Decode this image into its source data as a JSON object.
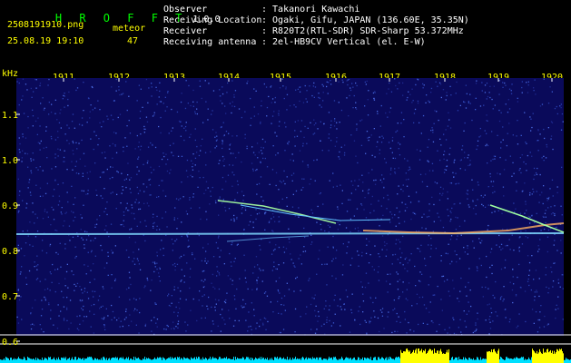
{
  "header": {
    "logo_text": "H R O F F T",
    "version": "1.0.0",
    "filename": "2508191910.png",
    "datetime": "25.08.19 19:10",
    "meteor_label": "meteor",
    "meteor_count": "47"
  },
  "info": {
    "rows": [
      {
        "label": "Observer",
        "value": ": Takanori Kawachi"
      },
      {
        "label": "Receiving Location",
        "value": ": Ogaki, Gifu, JAPAN (136.60E, 35.35N)"
      },
      {
        "label": "Receiver",
        "value": ": R820T2(RTL-SDR) SDR-Sharp 53.372MHz"
      },
      {
        "label": "Receiving antenna",
        "value": ": 2el-HB9CV Vertical (el. E-W)"
      }
    ]
  },
  "axis": {
    "unit": "kHz",
    "time_ticks": [
      "1911",
      "1912",
      "1913",
      "1914",
      "1915",
      "1916",
      "1917",
      "1918",
      "1919",
      "1920"
    ],
    "freq_ticks": [
      "1.1",
      "1.0",
      "0.9",
      "0.8",
      "0.7",
      "0.6"
    ]
  },
  "colors": {
    "background": "#0a0a5a",
    "label": "#ffff00",
    "carrier": "#7fd8ff",
    "meteor_trace": "#a0ffa0",
    "meter_cyan": "#00e0ff",
    "meter_yellow": "#ffff00"
  }
}
